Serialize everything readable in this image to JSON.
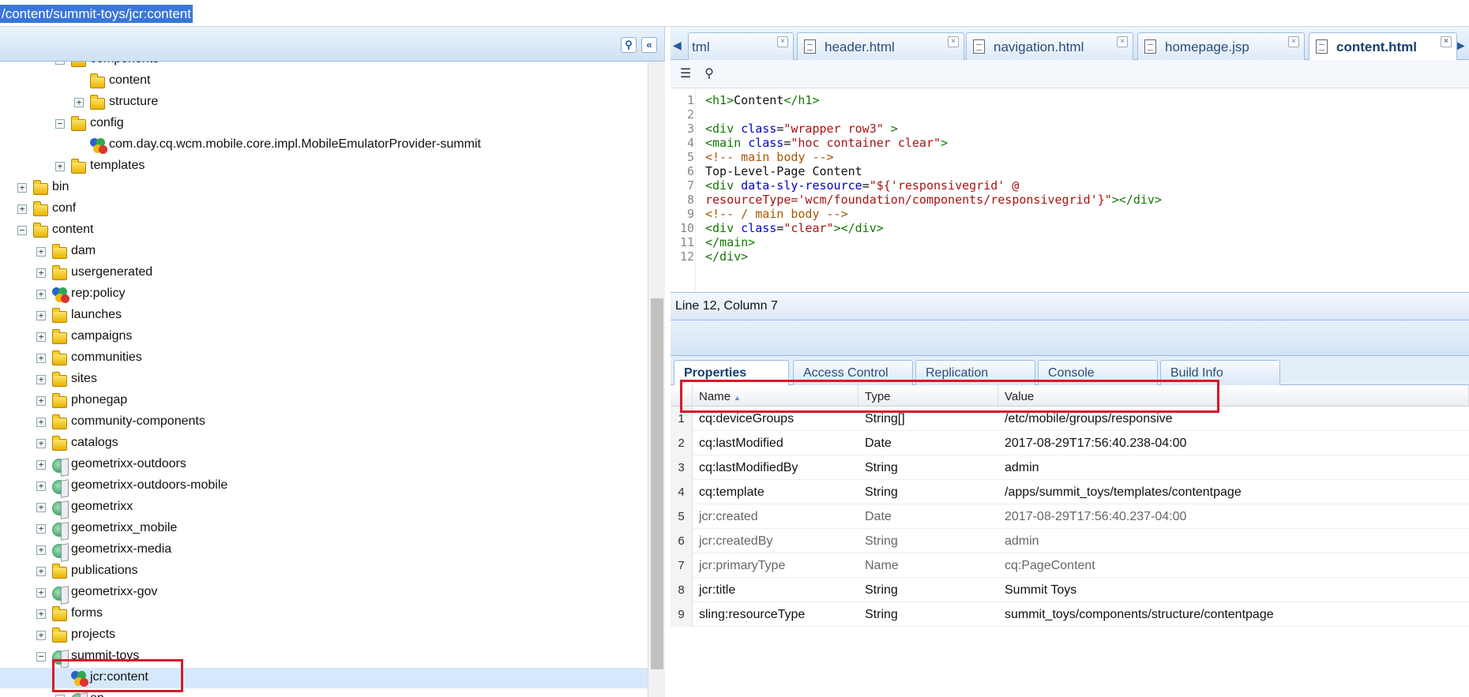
{
  "address": {
    "path": "/content/summit-toys/jcr:content"
  },
  "left_header": {
    "find_icon": "binoculars-icon",
    "collapse_icon": "double-chevron-left-icon",
    "collapse_glyph": "«",
    "find_glyph": "⚲"
  },
  "tree": {
    "items": [
      {
        "label": "components",
        "level": 3,
        "icon": "folder",
        "expanded": true
      },
      {
        "label": "content",
        "level": 4,
        "icon": "folder",
        "expanded": null
      },
      {
        "label": "structure",
        "level": 4,
        "icon": "folder",
        "expanded": false
      },
      {
        "label": "config",
        "level": 3,
        "icon": "folder",
        "expanded": true
      },
      {
        "label": "com.day.cq.wcm.mobile.core.impl.MobileEmulatorProvider-summit",
        "level": 4,
        "icon": "node",
        "expanded": null
      },
      {
        "label": "templates",
        "level": 3,
        "icon": "folder",
        "expanded": false
      },
      {
        "label": "bin",
        "level": 1,
        "icon": "folder",
        "expanded": false
      },
      {
        "label": "conf",
        "level": 1,
        "icon": "folder",
        "expanded": false
      },
      {
        "label": "content",
        "level": 1,
        "icon": "folder",
        "expanded": true
      },
      {
        "label": "dam",
        "level": 2,
        "icon": "folder",
        "expanded": false
      },
      {
        "label": "usergenerated",
        "level": 2,
        "icon": "folder",
        "expanded": false
      },
      {
        "label": "rep:policy",
        "level": 2,
        "icon": "node",
        "expanded": false
      },
      {
        "label": "launches",
        "level": 2,
        "icon": "folder",
        "expanded": false
      },
      {
        "label": "campaigns",
        "level": 2,
        "icon": "folder",
        "expanded": false
      },
      {
        "label": "communities",
        "level": 2,
        "icon": "folder",
        "expanded": false
      },
      {
        "label": "sites",
        "level": 2,
        "icon": "folder",
        "expanded": false
      },
      {
        "label": "phonegap",
        "level": 2,
        "icon": "folder",
        "expanded": false
      },
      {
        "label": "community-components",
        "level": 2,
        "icon": "folder",
        "expanded": false
      },
      {
        "label": "catalogs",
        "level": 2,
        "icon": "folder",
        "expanded": false
      },
      {
        "label": "geometrixx-outdoors",
        "level": 2,
        "icon": "page",
        "expanded": false
      },
      {
        "label": "geometrixx-outdoors-mobile",
        "level": 2,
        "icon": "page",
        "expanded": false
      },
      {
        "label": "geometrixx",
        "level": 2,
        "icon": "page",
        "expanded": false
      },
      {
        "label": "geometrixx_mobile",
        "level": 2,
        "icon": "page",
        "expanded": false
      },
      {
        "label": "geometrixx-media",
        "level": 2,
        "icon": "page",
        "expanded": false
      },
      {
        "label": "publications",
        "level": 2,
        "icon": "folder",
        "expanded": false
      },
      {
        "label": "geometrixx-gov",
        "level": 2,
        "icon": "page",
        "expanded": false
      },
      {
        "label": "forms",
        "level": 2,
        "icon": "folder",
        "expanded": false
      },
      {
        "label": "projects",
        "level": 2,
        "icon": "folder",
        "expanded": false
      },
      {
        "label": "summit-toys",
        "level": 2,
        "icon": "page",
        "expanded": true
      },
      {
        "label": "jcr:content",
        "level": 3,
        "icon": "node",
        "expanded": null,
        "selected": true
      },
      {
        "label": "en",
        "level": 3,
        "icon": "page",
        "expanded": false
      }
    ]
  },
  "tabs": [
    {
      "label": "tml",
      "active": false
    },
    {
      "label": "header.html",
      "active": false
    },
    {
      "label": "navigation.html",
      "active": false
    },
    {
      "label": "homepage.jsp",
      "active": false
    },
    {
      "label": "content.html",
      "active": true
    }
  ],
  "tab_close_glyph": "×",
  "tab_scroll_left_glyph": "◀",
  "tab_scroll_right_glyph": "▶",
  "editor_toolbar": {
    "format_icon": "format-icon",
    "find_icon": "binoculars-icon",
    "format_glyph": "☰",
    "find_glyph": "⚲"
  },
  "editor": {
    "lines": [
      {
        "n": "1",
        "parts": [
          [
            "c-tag",
            "<h1>"
          ],
          [
            "",
            "Content"
          ],
          [
            "c-tag",
            "</h1>"
          ]
        ]
      },
      {
        "n": "2",
        "parts": []
      },
      {
        "n": "3",
        "parts": [
          [
            "c-tag",
            "<div "
          ],
          [
            "c-attr",
            "class"
          ],
          [
            "",
            "="
          ],
          [
            "c-str",
            "\"wrapper row3\""
          ],
          [
            "c-tag",
            " >"
          ]
        ]
      },
      {
        "n": "4",
        "parts": [
          [
            "c-tag",
            "<main "
          ],
          [
            "c-attr",
            "class"
          ],
          [
            "",
            "="
          ],
          [
            "c-str",
            "\"hoc container clear\""
          ],
          [
            "c-tag",
            ">"
          ]
        ]
      },
      {
        "n": "5",
        "parts": [
          [
            "c-com",
            "<!-- main body -->"
          ]
        ]
      },
      {
        "n": "6",
        "parts": [
          [
            "",
            "Top-Level-Page Content"
          ]
        ]
      },
      {
        "n": "7",
        "parts": [
          [
            "c-tag",
            "<div "
          ],
          [
            "c-attr",
            "data-sly-resource"
          ],
          [
            "",
            "="
          ],
          [
            "c-str",
            "\"${'responsivegrid' @"
          ]
        ]
      },
      {
        "n": "8",
        "parts": [
          [
            "c-str",
            "resourceType='wcm/foundation/components/responsivegrid'}\""
          ],
          [
            "c-tag",
            "></div>"
          ]
        ]
      },
      {
        "n": "9",
        "parts": [
          [
            "c-com",
            "<!-- / main body -->"
          ]
        ]
      },
      {
        "n": "10",
        "parts": [
          [
            "c-tag",
            "<div "
          ],
          [
            "c-attr",
            "class"
          ],
          [
            "",
            "="
          ],
          [
            "c-str",
            "\"clear\""
          ],
          [
            "c-tag",
            "></div>"
          ]
        ]
      },
      {
        "n": "11",
        "parts": [
          [
            "c-tag",
            "</main>"
          ]
        ]
      },
      {
        "n": "12",
        "parts": [
          [
            "c-tag",
            "</div>"
          ]
        ]
      }
    ],
    "status": "Line 12, Column 7"
  },
  "prop_tabs": [
    {
      "label": "Properties",
      "active": true
    },
    {
      "label": "Access Control",
      "active": false
    },
    {
      "label": "Replication",
      "active": false
    },
    {
      "label": "Console",
      "active": false
    },
    {
      "label": "Build Info",
      "active": false
    }
  ],
  "grid": {
    "columns": [
      "Name",
      "Type",
      "Value"
    ],
    "sort_glyph": "▲",
    "rows": [
      {
        "n": "1",
        "name": "cq:deviceGroups",
        "type": "String[]",
        "value": "/etc/mobile/groups/responsive",
        "dim": false
      },
      {
        "n": "2",
        "name": "cq:lastModified",
        "type": "Date",
        "value": "2017-08-29T17:56:40.238-04:00",
        "dim": false
      },
      {
        "n": "3",
        "name": "cq:lastModifiedBy",
        "type": "String",
        "value": "admin",
        "dim": false
      },
      {
        "n": "4",
        "name": "cq:template",
        "type": "String",
        "value": "/apps/summit_toys/templates/contentpage",
        "dim": false
      },
      {
        "n": "5",
        "name": "jcr:created",
        "type": "Date",
        "value": "2017-08-29T17:56:40.237-04:00",
        "dim": true
      },
      {
        "n": "6",
        "name": "jcr:createdBy",
        "type": "String",
        "value": "admin",
        "dim": true
      },
      {
        "n": "7",
        "name": "jcr:primaryType",
        "type": "Name",
        "value": "cq:PageContent",
        "dim": true
      },
      {
        "n": "8",
        "name": "jcr:title",
        "type": "String",
        "value": "Summit Toys",
        "dim": false
      },
      {
        "n": "9",
        "name": "sling:resourceType",
        "type": "String",
        "value": "summit_toys/components/structure/contentpage",
        "dim": false
      }
    ]
  },
  "colors": {
    "highlight": "#d7192a",
    "accent": "#3a76d8"
  }
}
